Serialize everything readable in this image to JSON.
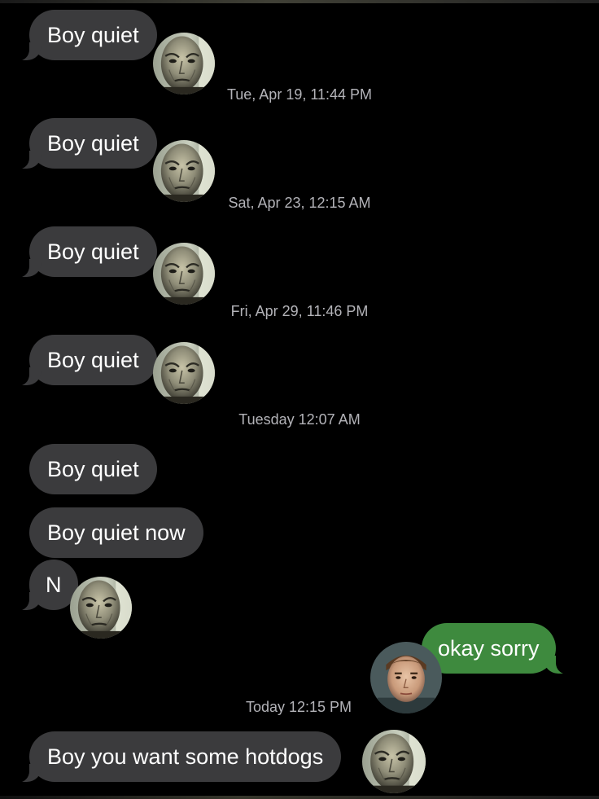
{
  "conversation": {
    "messages": [
      {
        "text": "Boy quiet",
        "direction": "incoming"
      },
      {
        "text": "Boy quiet",
        "direction": "incoming"
      },
      {
        "text": "Boy quiet",
        "direction": "incoming"
      },
      {
        "text": "Boy quiet",
        "direction": "incoming"
      },
      {
        "text": "Boy quiet",
        "direction": "incoming"
      },
      {
        "text": "Boy quiet now",
        "direction": "incoming"
      },
      {
        "text": "N",
        "direction": "incoming"
      },
      {
        "text": "okay sorry",
        "direction": "outgoing"
      },
      {
        "text": "Boy you want some hotdogs",
        "direction": "incoming"
      }
    ],
    "timestamps": [
      "Tue, Apr 19, 11:44 PM",
      "Sat, Apr 23, 12:15 AM",
      "Fri, Apr 29, 11:46 PM",
      "Tuesday 12:07 AM",
      "Today 12:15 PM"
    ]
  },
  "colors": {
    "background": "#000000",
    "incoming_bubble": "#3b3b3d",
    "outgoing_bubble": "#3e8a3e",
    "bubble_text": "#ffffff",
    "timestamp_text": "#b3b3b8"
  },
  "icons": {
    "sender_avatar": "pale-bald-man-avatar-icon",
    "me_avatar": "young-man-avatar-icon"
  }
}
